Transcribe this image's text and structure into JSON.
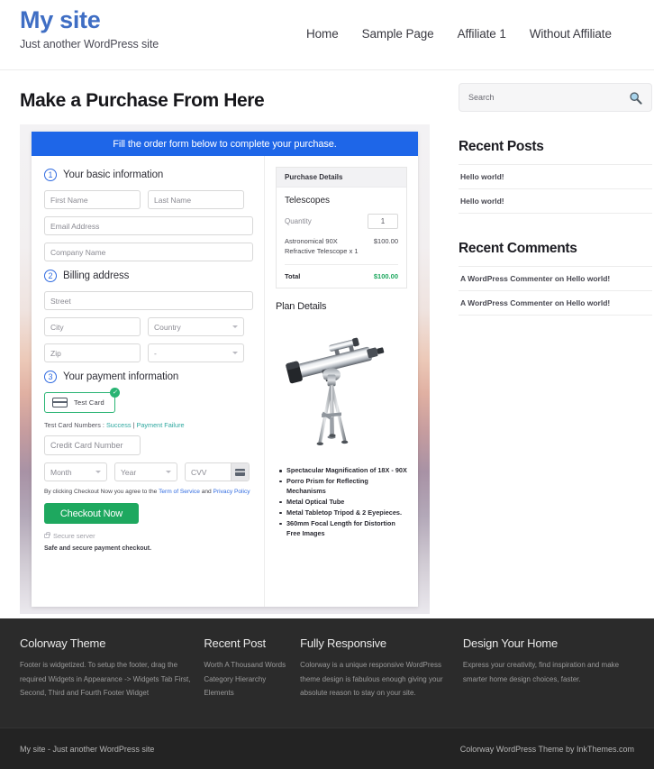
{
  "header": {
    "site_title": "My site",
    "tagline": "Just another WordPress site",
    "nav": [
      {
        "label": "Home"
      },
      {
        "label": "Sample Page"
      },
      {
        "label": "Affiliate 1"
      },
      {
        "label": "Without Affiliate"
      }
    ]
  },
  "main": {
    "page_title": "Make a Purchase From Here",
    "banner": "Fill the order form below to complete your purchase.",
    "sections": {
      "basic": {
        "number": "1",
        "title": "Your basic information"
      },
      "billing": {
        "number": "2",
        "title": "Billing address"
      },
      "payment": {
        "number": "3",
        "title": "Your payment information"
      }
    },
    "fields": {
      "first_name": "First Name",
      "last_name": "Last Name",
      "email": "Email Address",
      "company": "Company Name",
      "street": "Street",
      "city": "City",
      "country": "Country",
      "zip": "Zip",
      "state": "-",
      "credit_card": "Credit Card Number",
      "month": "Month",
      "year": "Year",
      "cvv": "CVV"
    },
    "payment": {
      "test_card_label": "Test  Card",
      "test_card_check": "✓",
      "test_numbers_prefix": "Test Card Numbers : ",
      "test_success": "Success",
      "test_separator": " | ",
      "test_failure": "Payment Failure",
      "terms_prefix": "By clicking Checkout Now you agree to the ",
      "terms_tos": "Term of Service",
      "terms_and": " and ",
      "terms_privacy": "Privacy Policy",
      "checkout_label": "Checkout Now",
      "secure_server": "Secure server",
      "safe_note": "Safe and secure payment checkout."
    },
    "purchase_details": {
      "heading": "Purchase Details",
      "product": "Telescopes",
      "quantity_label": "Quantity",
      "quantity_value": "1",
      "item_name": "Astronomical 90X Refractive Telescope x 1",
      "item_price": "$100.00",
      "total_label": "Total",
      "total_value": "$100.00"
    },
    "plan": {
      "heading": "Plan Details",
      "features": [
        "Spectacular Magnification of 18X - 90X",
        "Porro Prism for Reflecting Mechanisms",
        "Metal Optical Tube",
        "Metal Tabletop Tripod & 2 Eyepieces.",
        "360mm Focal Length for Distortion Free Images"
      ]
    }
  },
  "sidebar": {
    "search_placeholder": "Search",
    "recent_posts_title": "Recent Posts",
    "recent_posts": [
      "Hello world!",
      "Hello world!"
    ],
    "recent_comments_title": "Recent Comments",
    "recent_comments": [
      "A WordPress Commenter on Hello world!",
      "A WordPress Commenter on Hello world!"
    ]
  },
  "footer": {
    "columns": [
      {
        "title": "Colorway Theme",
        "text": "Footer is widgetized. To setup the footer, drag the required Widgets in Appearance -> Widgets Tab First, Second, Third and Fourth Footer Widget"
      },
      {
        "title": "Recent Post",
        "items": [
          "Worth A Thousand Words",
          "Category Hierarchy",
          "Elements"
        ]
      },
      {
        "title": "Fully Responsive",
        "text": "Colorway is a unique responsive WordPress theme design is fabulous enough giving your absolute reason to stay on your site."
      },
      {
        "title": "Design Your Home",
        "text": "Express your creativity, find inspiration and make smarter home design choices, faster."
      }
    ],
    "bottom_left": "My site - Just another WordPress site",
    "bottom_right": "Colorway WordPress Theme by InkThemes.com"
  },
  "colors": {
    "brand": "#3f6ec4",
    "banner": "#1e66e8",
    "accent_green": "#1ea85f",
    "footer_bg": "#2b2b2b",
    "footer_bottom_bg": "#232323"
  }
}
